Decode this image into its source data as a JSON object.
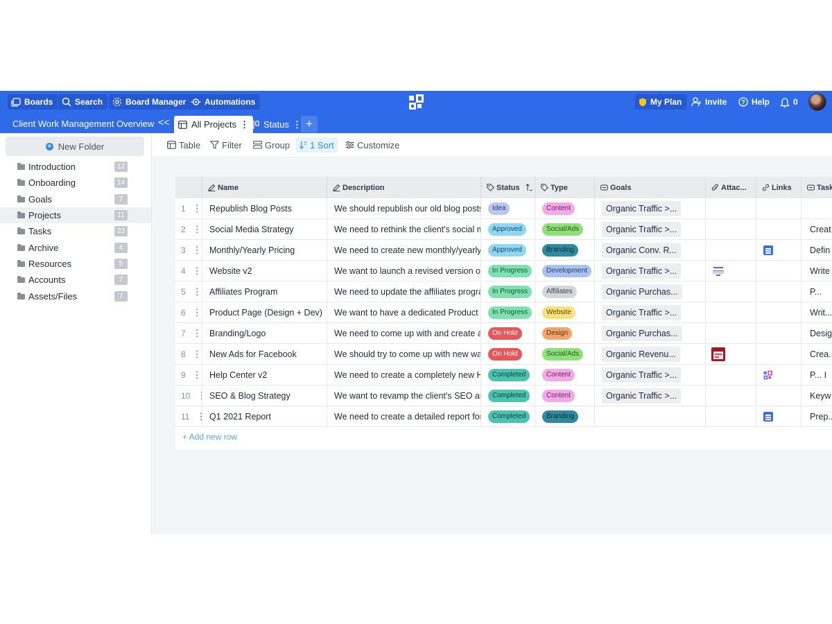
{
  "topbar": {
    "boards": "Boards",
    "search": "Search",
    "board_manager": "Board Manager",
    "automations": "Automations",
    "my_plan": "My Plan",
    "invite": "Invite",
    "help": "Help",
    "notifications_count": "0"
  },
  "subbar": {
    "workspace": "Client Work Management Overview",
    "collapse": "<<",
    "tabs": [
      {
        "label": "All Projects"
      },
      {
        "label": "Status"
      }
    ],
    "add_tab": "+"
  },
  "sidebar": {
    "new_folder": "New Folder",
    "folders": [
      {
        "label": "Introduction",
        "count": "12"
      },
      {
        "label": "Onboarding",
        "count": "14"
      },
      {
        "label": "Goals",
        "count": "7"
      },
      {
        "label": "Projects",
        "count": "11"
      },
      {
        "label": "Tasks",
        "count": "22"
      },
      {
        "label": "Archive",
        "count": "4"
      },
      {
        "label": "Resources",
        "count": "5"
      },
      {
        "label": "Accounts",
        "count": "7"
      },
      {
        "label": "Assets/Files",
        "count": "7"
      }
    ]
  },
  "toolbar": {
    "table": "Table",
    "filter": "Filter",
    "group": "Group",
    "sort": "1 Sort",
    "customize": "Customize"
  },
  "columns": {
    "name": "Name",
    "description": "Description",
    "status": "Status",
    "type": "Type",
    "goals": "Goals",
    "attachments": "Attac...",
    "links": "Links",
    "tasks": "Task"
  },
  "rows": [
    {
      "num": "1",
      "name": "Republish Blog Posts",
      "description": "We should republish our old blog posts",
      "status": "Idea",
      "type": "Content",
      "goal": "Organic Traffic >...",
      "task": ""
    },
    {
      "num": "2",
      "name": "Social Media Strategy",
      "description": "We need to rethink the client's social m",
      "status": "Approved",
      "type": "Social/Ads",
      "goal": "Organic Traffic >...",
      "task": "Creat"
    },
    {
      "num": "3",
      "name": "Monthly/Yearly Pricing",
      "description": "We need to create new monthly/yearly p",
      "status": "Approved",
      "type": "Branding",
      "goal": "Organic Conv. R...",
      "task": "Defin"
    },
    {
      "num": "4",
      "name": "Website v2",
      "description": "We want to launch a revised version of",
      "status": "In Progress",
      "type": "Development",
      "goal": "Organic Traffic >...",
      "task": "Write"
    },
    {
      "num": "5",
      "name": "Affiliates Program",
      "description": "We need to update the affiliates progra",
      "status": "In Progress",
      "type": "Affiliates",
      "goal": "Organic Purchas...",
      "task": "P..."
    },
    {
      "num": "6",
      "name": "Product Page (Design + Dev)",
      "description": "We want to have a dedicated Product P",
      "status": "In Progress",
      "type": "Website",
      "goal": "Organic Traffic >...",
      "task": "Writ..."
    },
    {
      "num": "7",
      "name": "Branding/Logo",
      "description": "We need to come up with and create a",
      "status": "On Hold",
      "type": "Design",
      "goal": "Organic Purchas...",
      "task": "Desig"
    },
    {
      "num": "8",
      "name": "New Ads for Facebook",
      "description": "We should try to come up with new way",
      "status": "On Hold",
      "type": "Social/Ads",
      "goal": "Organic Revenu...",
      "task": "Crea..."
    },
    {
      "num": "9",
      "name": "Help Center v2",
      "description": "We need to create a completely new He",
      "status": "Completed",
      "type": "Content",
      "goal": "Organic Traffic >...",
      "task": "P...   I"
    },
    {
      "num": "10",
      "name": "SEO & Blog Strategy",
      "description": "We want to revamp the client's SEO anc",
      "status": "Completed",
      "type": "Content",
      "goal": "Organic Traffic >...",
      "task": "Keyw"
    },
    {
      "num": "11",
      "name": "Q1 2021 Report",
      "description": "We need to create a detailed report for",
      "status": "Completed",
      "type": "Branding",
      "goal": "",
      "task": "Prep..."
    }
  ],
  "add_row": "+ Add new row",
  "colors": {
    "brand_blue": "#2f6ae8",
    "status_idea": "#b9c8f2",
    "status_approved": "#8fd6f5",
    "status_in_progress": "#7fe0b0",
    "status_on_hold": "#e8565a",
    "status_completed": "#4cc3b0"
  }
}
